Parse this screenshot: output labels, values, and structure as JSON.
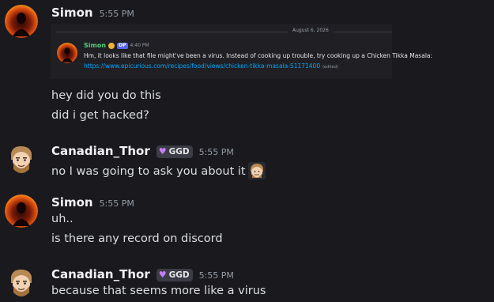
{
  "messages": [
    {
      "username": "Simon",
      "timestamp": "5:55 PM",
      "lines": [
        "hey did you do this",
        "did i get hacked?"
      ]
    },
    {
      "username": "Canadian_Thor",
      "timestamp": "5:55 PM",
      "tag": "GGD",
      "lines": [
        "no I was going to ask you about it"
      ]
    },
    {
      "username": "Simon",
      "timestamp": "5:55 PM",
      "lines": [
        "uh..",
        "is there any record on discord"
      ]
    },
    {
      "username": "Canadian_Thor",
      "timestamp": "5:55 PM",
      "tag": "GGD",
      "lines": [
        "because that seems more like a virus"
      ]
    }
  ],
  "embed": {
    "date": "August 6, 2026",
    "username": "Simon",
    "badge": "OP",
    "time": "4:40 PM",
    "text": "Hm, it looks like that file might've been a virus. Instead of cooking up trouble, try cooking up a Chicken Tikka Masala:",
    "link": "https://www.epicurious.com/recipes/food/views/chicken-tikka-masala-51171400",
    "edited": "(edited)"
  },
  "colors": {
    "background": "#1a1a1e",
    "username": "#f2f3f5",
    "timestamp": "#949ba4",
    "link": "#00a8fc",
    "embed_name": "#4fd37a",
    "tag_heart": "#c77dff"
  }
}
